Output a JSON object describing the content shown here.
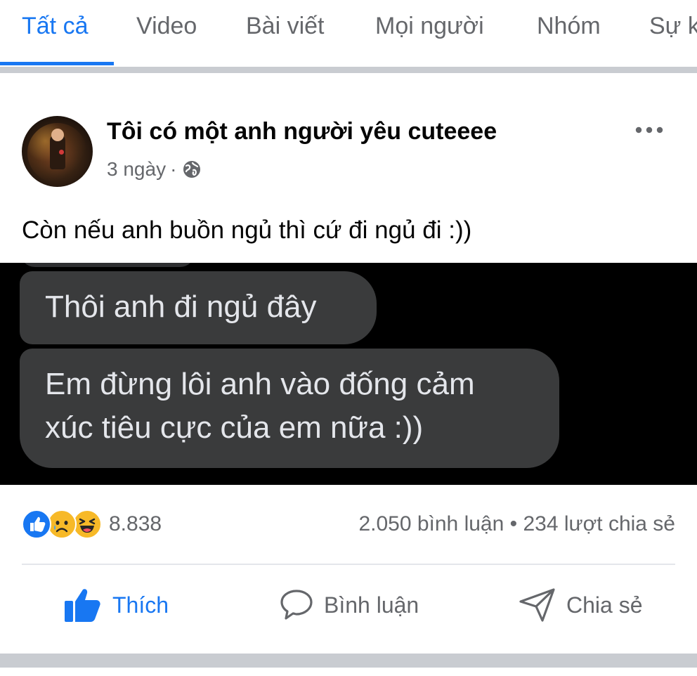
{
  "tabs": [
    {
      "label": "Tất cả",
      "active": true
    },
    {
      "label": "Video"
    },
    {
      "label": "Bài viết"
    },
    {
      "label": "Mọi người"
    },
    {
      "label": "Nhóm"
    },
    {
      "label": "Sự k"
    }
  ],
  "post": {
    "author": "Tôi có một anh người yêu cuteeee",
    "time": "3 ngày",
    "separator": "·",
    "privacy_icon": "globe-icon",
    "more_icon": "more-horizontal-icon",
    "caption": "Còn nếu anh buồn ngủ thì cứ đi ngủ đi :))",
    "image": {
      "messages": [
        "Thôi anh đi ngủ đây",
        "Em đừng lôi anh vào đống cảm",
        "xúc tiêu cực của em nữa :))"
      ]
    },
    "reactions": {
      "icons": [
        "like-reaction-icon",
        "sad-reaction-icon",
        "haha-reaction-icon"
      ],
      "count": "8.838"
    },
    "stats": "2.050 bình luận • 234 lượt chia sẻ"
  },
  "actions": {
    "like": "Thích",
    "comment": "Bình luận",
    "share": "Chia sẻ"
  },
  "colors": {
    "accent": "#1877f2",
    "secondary_text": "#65676b",
    "bubble": "#3a3b3c"
  }
}
